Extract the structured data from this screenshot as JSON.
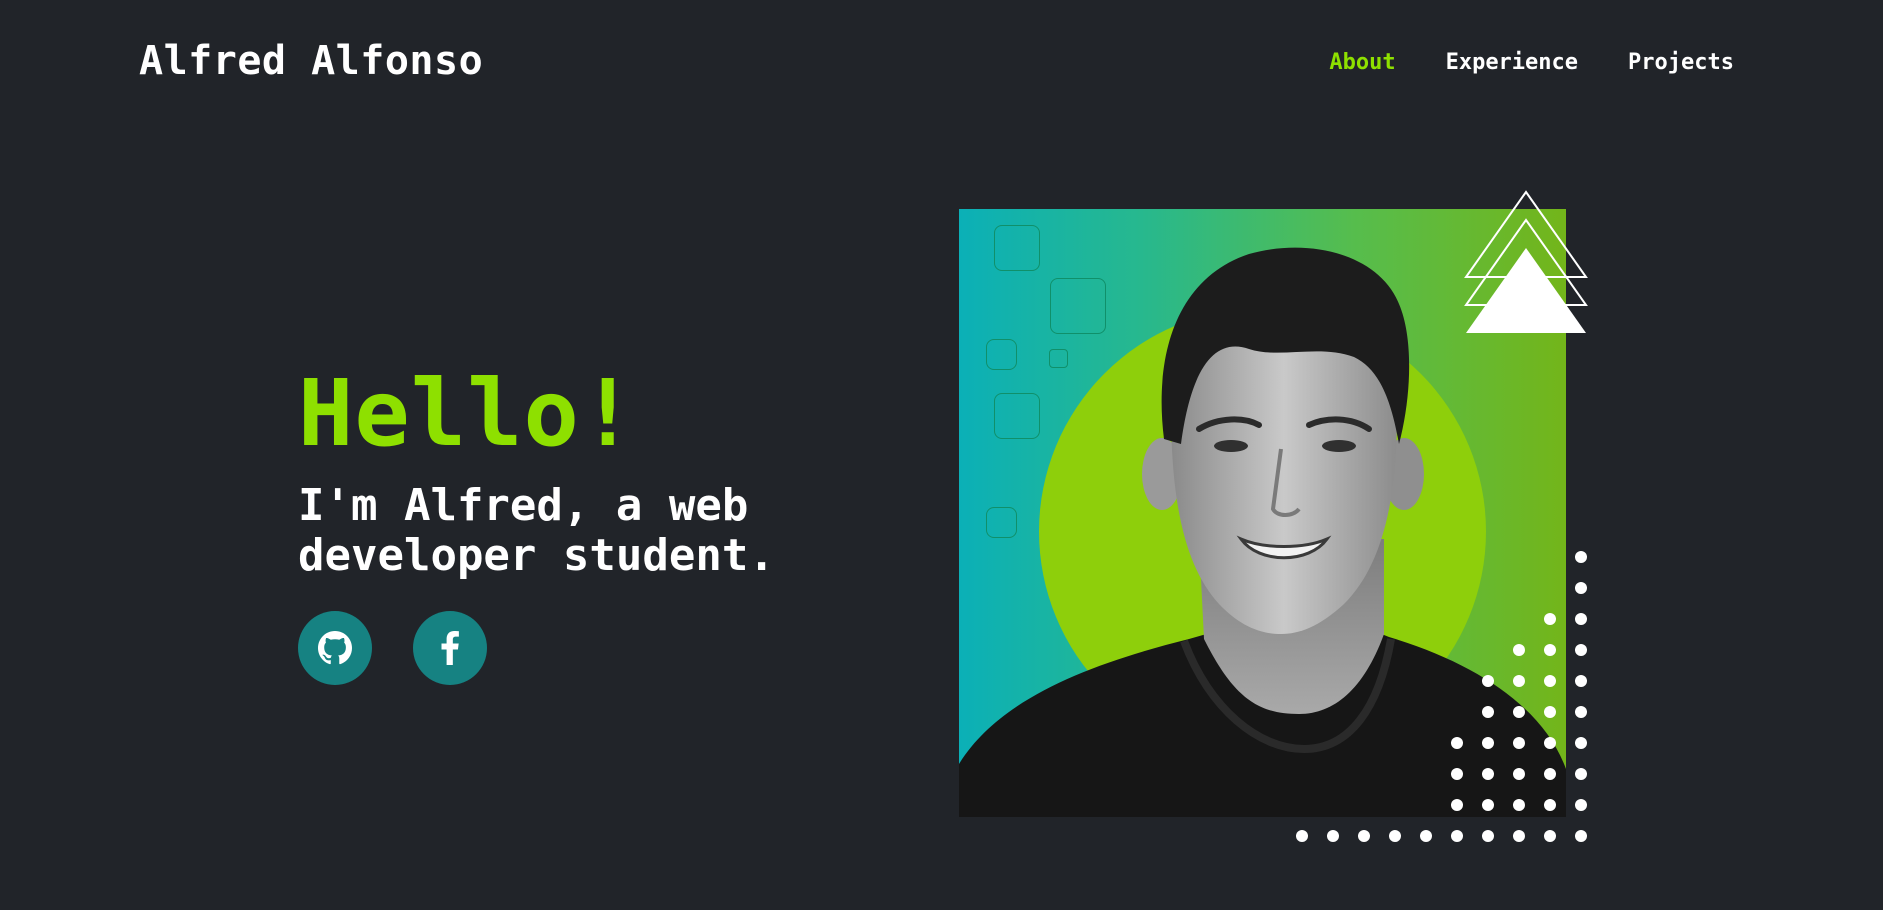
{
  "header": {
    "brand": "Alfred Alfonso",
    "nav": [
      {
        "label": "About",
        "active": true
      },
      {
        "label": "Experience",
        "active": false
      },
      {
        "label": "Projects",
        "active": false
      }
    ]
  },
  "hero": {
    "greeting": "Hello!",
    "intro_line1": "I'm Alfred, a web",
    "intro_line2": "developer student.",
    "socials": [
      {
        "icon": "github-icon"
      },
      {
        "icon": "facebook-icon"
      }
    ]
  },
  "colors": {
    "background": "#212429",
    "accent": "#8ee000",
    "social_bg": "#168282",
    "panel_gradient_start": "#0bb0b7",
    "panel_gradient_end": "#73b51a"
  },
  "art": {
    "decorations": [
      "outlined-squares",
      "triangles",
      "dot-grid"
    ]
  }
}
